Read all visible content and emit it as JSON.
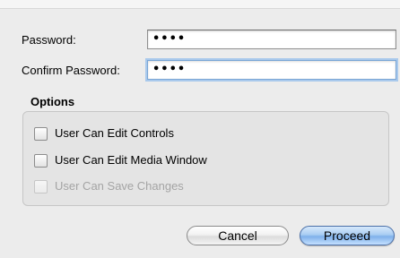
{
  "fields": {
    "password_label": "Password:",
    "password_value": "••••",
    "confirm_label": "Confirm Password:",
    "confirm_value": "••••"
  },
  "options": {
    "title": "Options",
    "items": [
      {
        "label": "User Can Edit Controls",
        "checked": false,
        "enabled": true
      },
      {
        "label": "User Can Edit Media Window",
        "checked": false,
        "enabled": true
      },
      {
        "label": "User Can Save Changes",
        "checked": false,
        "enabled": false
      }
    ]
  },
  "buttons": {
    "cancel_label": "Cancel",
    "proceed_label": "Proceed"
  },
  "colors": {
    "focus_ring": "#a9c9ec",
    "default_button": "#7fb0ea"
  }
}
